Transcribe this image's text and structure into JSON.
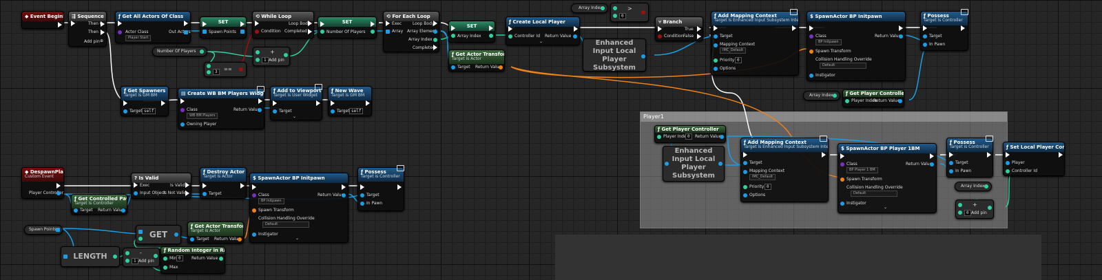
{
  "graph": {
    "nodes": {
      "event_beginplay": {
        "title": "Event BeginPlay"
      },
      "sequence": {
        "title": "Sequence",
        "pins": [
          "Then 0",
          "Then 1"
        ],
        "add_pin": "Add pin"
      },
      "get_all_actors": {
        "title": "Get All Actors Of Class",
        "pins": {
          "actor_class": "Actor Class",
          "actor_class_value": "Player Start",
          "out_actors": "Out Actors"
        }
      },
      "set_spawn_points": {
        "title": "SET",
        "pin": "Spawn Points"
      },
      "while_loop": {
        "title": "While Loop",
        "pins": {
          "condition": "Condition",
          "loop_body": "Loop Body",
          "completed": "Completed"
        }
      },
      "set_number_of_players": {
        "title": "SET",
        "pin": "Number Of Players"
      },
      "number_of_players_var": {
        "label": "Number Of Players"
      },
      "add_int": {
        "value": "1",
        "add_pin": "Add pin"
      },
      "equal_int": {
        "value": "3",
        "op": "=="
      },
      "for_each_loop": {
        "title": "For Each Loop",
        "pins": {
          "exec": "Exec",
          "array": "Array",
          "loop_body": "Loop Body",
          "array_element": "Array Element",
          "array_index": "Array Index",
          "completed": "Completed"
        }
      },
      "set_array_index": {
        "title": "SET",
        "pin": "Array Index"
      },
      "array_index_var_top": {
        "label": "Array Index"
      },
      "greater_node": {
        "op": ">",
        "value": "0"
      },
      "get_actor_transform_top": {
        "title": "Get Actor Transform",
        "subtitle": "Target is Actor",
        "pins": {
          "target": "Target",
          "return": "Return Value"
        }
      },
      "create_local_player": {
        "title": "Create Local Player",
        "pins": {
          "controller_id": "Controller Id",
          "return": "Return Value"
        }
      },
      "eilps_top": {
        "label": "Enhanced Input Local Player Subsystem"
      },
      "branch": {
        "title": "Branch",
        "pins": {
          "condition": "Condition",
          "true": "True",
          "false": "False"
        }
      },
      "add_mapping_context_top": {
        "title": "Add Mapping Context",
        "subtitle": "Target is Enhanced Input Subsystem Interface",
        "pins": {
          "target": "Target",
          "mapping_context": "Mapping Context",
          "mapping_value": "IMC_Default",
          "priority": "Priority",
          "priority_value": "0",
          "options": "Options"
        }
      },
      "spawn_actor_top": {
        "title": "SpawnActor BP Initpawn",
        "pins": {
          "class": "Class",
          "class_value": "BP Initpawn",
          "return": "Return Value",
          "spawn_transform": "Spawn Transform",
          "collision": "Collision Handling Override",
          "collision_value": "Default",
          "instigator": "Instigator"
        }
      },
      "possess_top": {
        "title": "Possess",
        "subtitle": "Target is Controller",
        "pins": {
          "target": "Target",
          "in_pawn": "In Pawn"
        }
      },
      "array_index_var_mid": {
        "label": "Array Index"
      },
      "get_player_controller_top": {
        "title": "Get Player Controller",
        "pins": {
          "player_index": "Player Index",
          "return": "Return Value"
        }
      },
      "get_spawners": {
        "title": "Get Spawners",
        "subtitle": "Target is GM BM",
        "pins": {
          "target": "Target",
          "self": "self"
        }
      },
      "create_widget": {
        "title": "Create WB BM Players Widget",
        "pins": {
          "class": "Class",
          "class_value": "WB BM Players",
          "return": "Return Value",
          "owning_player": "Owning Player"
        }
      },
      "add_to_viewport": {
        "title": "Add to Viewport",
        "subtitle": "Target is User Widget",
        "pins": {
          "target": "Target"
        }
      },
      "new_wave": {
        "title": "New Wave",
        "subtitle": "Target is GM BM",
        "pins": {
          "target": "Target",
          "self": "self"
        }
      },
      "despawn_player": {
        "title": "DespawnPlayer",
        "subtitle": "Custom Event",
        "pins": {
          "player_controller": "Player Controller"
        }
      },
      "get_controlled_pawn": {
        "title": "Get Controlled Pawn",
        "subtitle": "Target is Controller",
        "pins": {
          "target": "Target",
          "return": "Return Value"
        }
      },
      "is_valid": {
        "title": "Is Valid",
        "pins": {
          "exec": "Exec",
          "input_object": "Input Object",
          "is_valid": "Is Valid",
          "is_not_valid": "Is Not Valid"
        }
      },
      "destroy_actor": {
        "title": "Destroy Actor",
        "subtitle": "Target is Actor",
        "pins": {
          "target": "Target"
        }
      },
      "spawn_actor_bottom": {
        "title": "SpawnActor BP Initpawn",
        "pins": {
          "class": "Class",
          "class_value": "BP Initpawn",
          "return": "Return Value",
          "spawn_transform": "Spawn Transform",
          "collision": "Collision Handling Override",
          "collision_value": "Default",
          "instigator": "Instigator"
        }
      },
      "possess_bottom": {
        "title": "Possess",
        "subtitle": "Target is Controller",
        "pins": {
          "target": "Target",
          "in_pawn": "In Pawn"
        }
      },
      "spawn_points_var": {
        "label": "Spawn Points"
      },
      "get_array": {
        "label": "GET"
      },
      "get_actor_transform_bottom": {
        "title": "Get Actor Transform",
        "subtitle": "Target is Actor",
        "pins": {
          "target": "Target",
          "return": "Return Value"
        }
      },
      "length_node": {
        "label": "LENGTH"
      },
      "subtract_node": {
        "value": "1",
        "op": "-",
        "add_pin": "Add pin"
      },
      "random_int": {
        "title": "Random Integer in Range",
        "pins": {
          "min": "Min",
          "min_value": "0",
          "max": "Max",
          "return": "Return Value"
        }
      },
      "get_player_controller_p1": {
        "title": "Get Player Controller",
        "pins": {
          "player_index": "Player Index",
          "player_index_value": "0",
          "return": "Return Value"
        }
      },
      "eilps_p1": {
        "label": "Enhanced Input Local Player Subsystem"
      },
      "add_mapping_context_p1": {
        "title": "Add Mapping Context",
        "subtitle": "Target is Enhanced Input Subsystem Interface",
        "pins": {
          "target": "Target",
          "mapping_context": "Mapping Context",
          "mapping_value": "IMC_Default",
          "priority": "Priority",
          "priority_value": "0",
          "options": "Options"
        }
      },
      "spawn_actor_p1": {
        "title": "SpawnActor BP Player 1BM",
        "pins": {
          "class": "Class",
          "class_value": "BP Player 1 BM",
          "return": "Return Value",
          "spawn_transform": "Spawn Transform",
          "collision": "Collision Handling Override",
          "collision_value": "Default",
          "instigator": "Instigator"
        }
      },
      "possess_p1": {
        "title": "Possess",
        "subtitle": "Target is Controller",
        "pins": {
          "target": "Target",
          "in_pawn": "In Pawn"
        }
      },
      "set_local_player_controller_id": {
        "title": "Set Local Player Controller ID",
        "pins": {
          "player": "Player",
          "controller_id": "Controller Id"
        }
      },
      "array_index_var_p1": {
        "label": "Array Index"
      },
      "add_node_p1": {
        "value": "0",
        "add_pin": "Add pin"
      }
    },
    "comment_box": {
      "title": "Player1"
    },
    "colors": {
      "exec": "#ffffff",
      "object": "#1a9ee8",
      "int": "#2fd1a0",
      "bool": "#9c1010",
      "struct": "#f0821a",
      "class": "#7a2fc4",
      "event_header": "#7a0d0d",
      "function_header": "#215a8a"
    }
  }
}
